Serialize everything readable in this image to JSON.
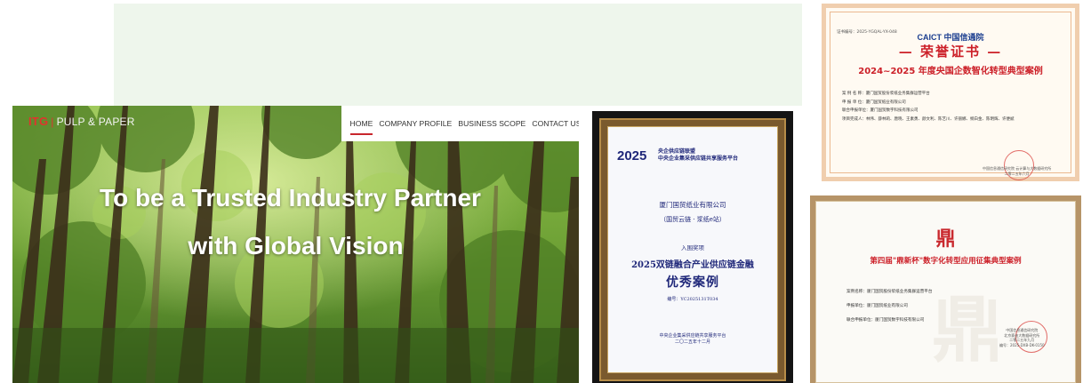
{
  "hero": {
    "brand_mark": "ITG",
    "brand_separator": "|",
    "brand_name": "PULP & PAPER",
    "nav": [
      "HOME",
      "COMPANY PROFILE",
      "BUSINESS SCOPE",
      "CONTACT US"
    ],
    "active_nav": "HOME",
    "headline_1": "To be a Trusted Industry Partner",
    "headline_2": "with Global Vision"
  },
  "plaque": {
    "year": "2025",
    "org_line_1": "央企供应链联盟",
    "org_line_2": "中央企业集采供应链共享服务平台",
    "company": "厦门国贸纸业有限公司",
    "brand": "（国贸云链 · 浆纸e站）",
    "selected": "入围奖项",
    "award_name": "2025双链融合产业供应链金融",
    "award_level": "优秀案例",
    "number": "编号：YC2025131T034",
    "issuer": "中央企业集采供应链共享服务平台",
    "date": "二〇二五年十二月"
  },
  "cert1": {
    "number": "证书编号：2025-YGQAL-YX-048",
    "logo": "CAICT 中国信通院",
    "title": "— 荣誉证书 —",
    "subtitle": "2024~2025 年度央国企数智化转型典型案例",
    "lines": [
      "案 例 名 称：厦门国贸股份浆纸业务集群运营平台",
      "申 报 单 位：厦门国贸纸业有限公司",
      "联合申报单位：厦门国贸数字科技有限公司",
      "项目完成人：林伟、薛林莉、唐晓、王素勇、颜文利、陈艺川、许丽娜、纲白金、陈明辉、许便斌"
    ],
    "issuer": "中国信息通信研究院 云计算与大数据研究所",
    "date": "二零二五年六月"
  },
  "cert2": {
    "logo": "鼎",
    "title": "第四届\"鼎新杯\"数字化转型应用征集典型案例",
    "lines": [
      "案例名称：厦门国贸股份浆纸业务集群运营平台",
      "申报单位：厦门国贸纸业有限公司",
      "联合申报单位：厦门国贸数字科技有限公司"
    ],
    "issuer_1": "中国信息通信研究院",
    "issuer_2": "北京赛迪大数据研究所",
    "date": "二零二五年九月",
    "number": "编号：2025-DXB-DK-0150"
  },
  "colors": {
    "banner_bg": "#eef6ec",
    "nav_active_underline": "#c8272d",
    "cert_red": "#cc1f28",
    "plaque_blue": "#20287a"
  }
}
